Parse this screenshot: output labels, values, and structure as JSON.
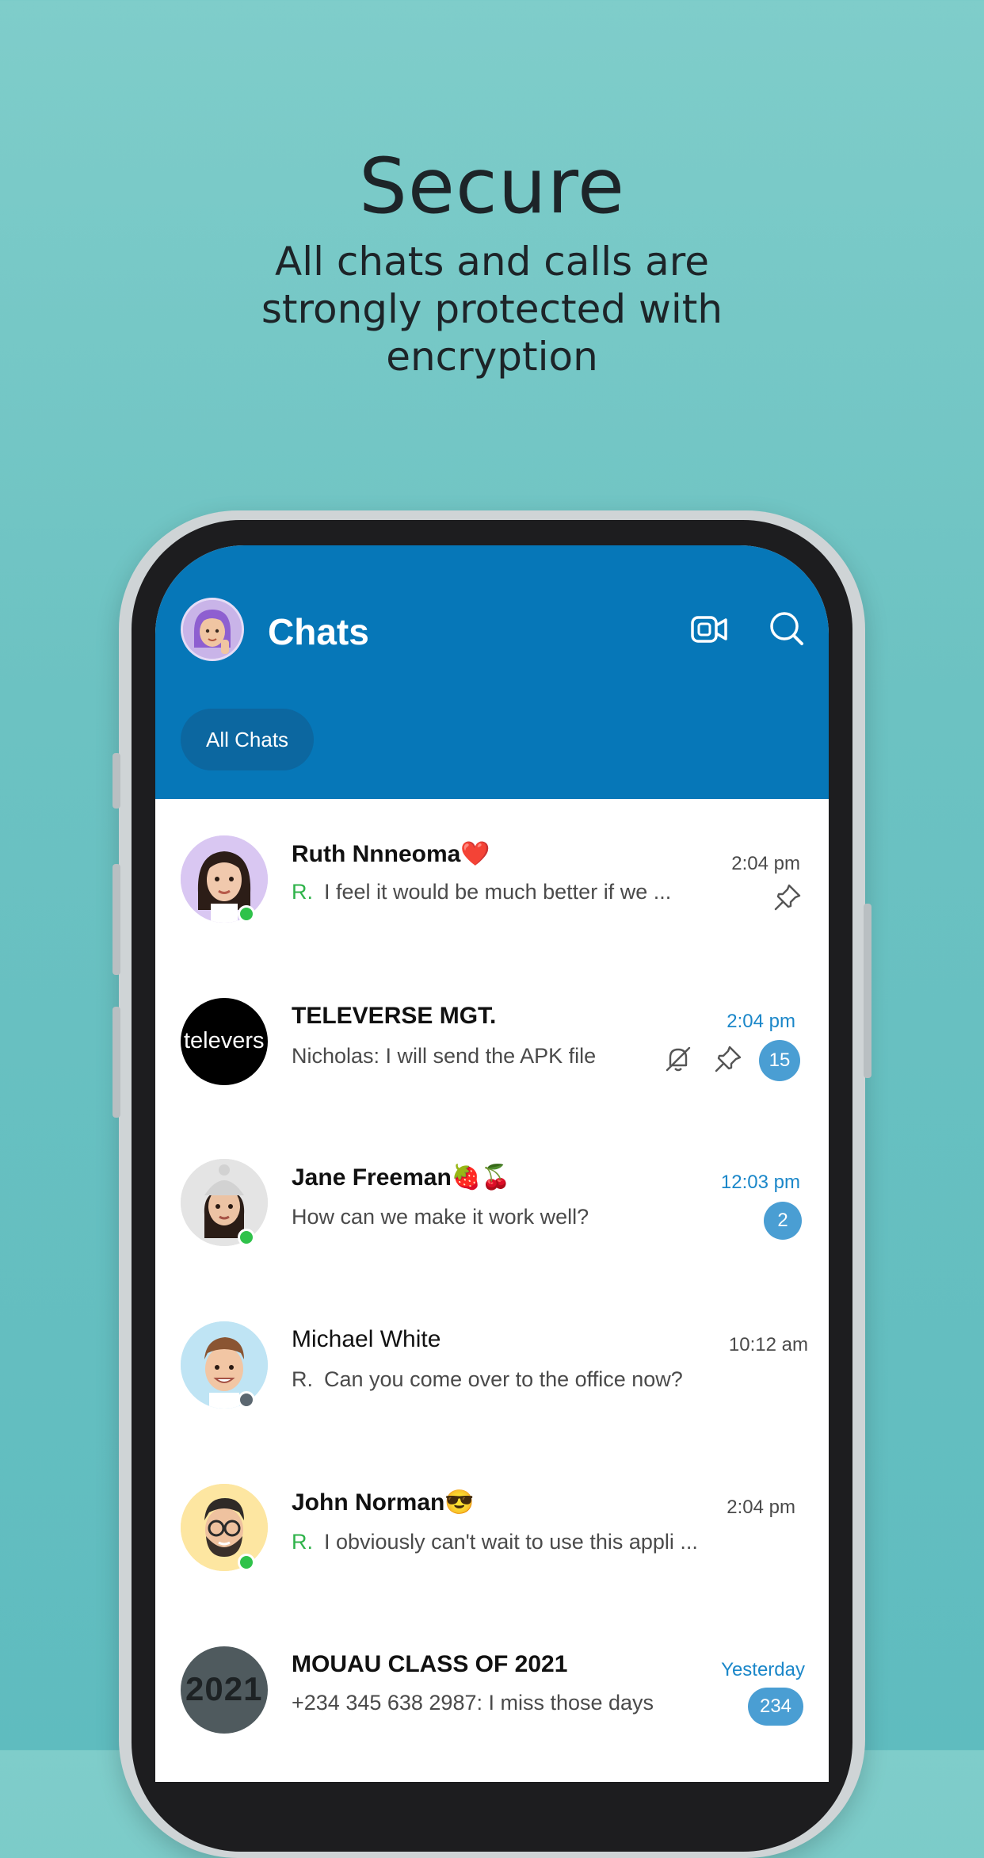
{
  "hero": {
    "title": "Secure",
    "subtitle": "All chats and calls are strongly protected with encryption"
  },
  "header": {
    "title": "Chats",
    "icons": [
      "profile-avatar",
      "video-call-icon",
      "search-icon"
    ],
    "accent": "#0677b8"
  },
  "tabs": [
    {
      "label": "All Chats",
      "selected": true
    }
  ],
  "chats": [
    {
      "name": "Ruth Nnneoma❤️",
      "sender_tag": "R.",
      "preview": "I feel it would be much better if we ...",
      "time": "2:04 pm",
      "pinned": true,
      "online": true
    },
    {
      "name": "TELEVERSE MGT.",
      "avatar_text": "televers",
      "preview": "Nicholas: I will send the APK file",
      "time": "2:04 pm",
      "muted": true,
      "pinned": true,
      "unread": "15"
    },
    {
      "name": "Jane Freeman🍓🍒",
      "preview": "How can we make it work well?",
      "time": "12:03 pm",
      "unread": "2",
      "online": true
    },
    {
      "name": "Michael White",
      "sender_tag": "R.",
      "preview": "Can you come over to the office now?",
      "time": "10:12 am",
      "online": false
    },
    {
      "name": "John Norman😎",
      "sender_tag": "R.",
      "preview": "I obviously can't wait to use this appli ...",
      "time": "2:04 pm",
      "online": true
    },
    {
      "name": "MOUAU CLASS OF 2021",
      "avatar_text": "2021",
      "preview": "+234 345 638 2987: I miss those days",
      "time": "Yesterday",
      "unread": "234"
    }
  ],
  "colors": {
    "online": "#2fc24a",
    "offline": "#5b6770",
    "unread_badge": "#4a9ed3",
    "unread_time": "#1b87c9",
    "sender_tag": "#2fb34a"
  }
}
